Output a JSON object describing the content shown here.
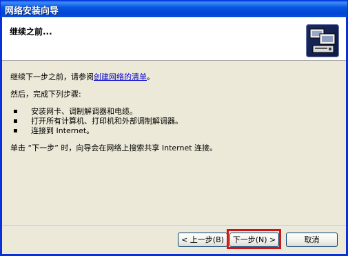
{
  "window": {
    "title": "网络安装向导"
  },
  "header": {
    "title": "继续之前..."
  },
  "content": {
    "para1_prefix": "继续下一步之前，请参阅",
    "para1_link": "创建网络的清单",
    "para1_suffix": "。",
    "para2": "然后，完成下列步骤:",
    "steps": [
      "安装网卡、调制解调器和电缆。",
      "打开所有计算机、打印机和外部调制解调器。",
      "连接到 Internet。"
    ],
    "para3": "单击 “下一步” 时，向导会在网络上搜索共享 Internet 连接。"
  },
  "buttons": {
    "back": "< 上一步(B)",
    "next": "下一步(N) >",
    "cancel": "取消"
  },
  "colors": {
    "title_bar": "#0046d5",
    "highlight": "#d01515",
    "link": "#0000cc"
  },
  "icons": {
    "header": "network-computer-icon"
  }
}
